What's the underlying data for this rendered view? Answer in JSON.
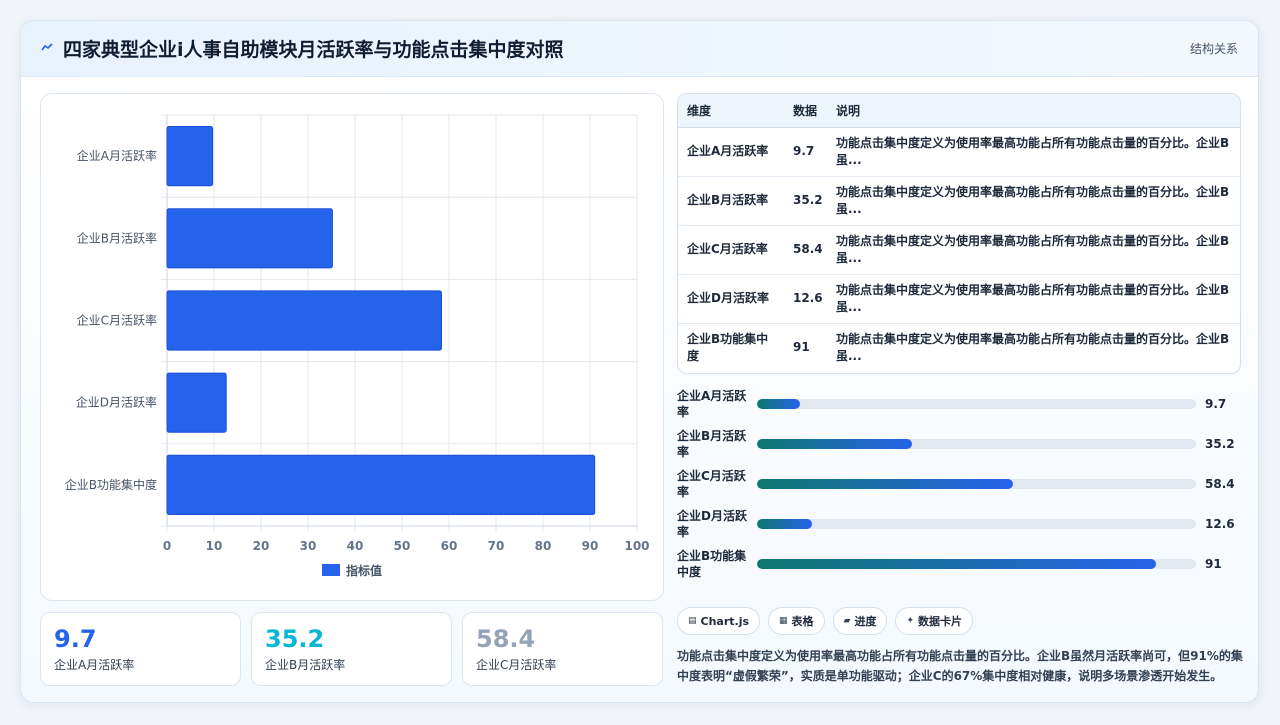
{
  "header": {
    "title": "四家典型企业i人事自助模块月活跃率与功能点击集中度对照",
    "tag": "结构关系",
    "icon": "trend-line-icon"
  },
  "chart_data": {
    "type": "bar",
    "orientation": "horizontal",
    "categories": [
      "企业A月活跃率",
      "企业B月活跃率",
      "企业C月活跃率",
      "企业D月活跃率",
      "企业B功能集中度"
    ],
    "series": [
      {
        "name": "指标值",
        "values": [
          9.7,
          35.2,
          58.4,
          12.6,
          91
        ],
        "color": "#2563eb"
      }
    ],
    "xlim": [
      0,
      100
    ],
    "x_ticks": [
      0,
      10,
      20,
      30,
      40,
      50,
      60,
      70,
      80,
      90,
      100
    ],
    "grid": true,
    "legend": "bottom"
  },
  "stats": [
    {
      "value": "9.7",
      "label": "企业A月活跃率",
      "color": "#2563eb"
    },
    {
      "value": "35.2",
      "label": "企业B月活跃率",
      "color": "#06b6d4"
    },
    {
      "value": "58.4",
      "label": "企业C月活跃率",
      "color": "#94a3b8"
    }
  ],
  "table": {
    "headers": [
      "维度",
      "数据",
      "说明"
    ],
    "rows": [
      {
        "dim": "企业A月活跃率",
        "val": "9.7",
        "desc": "功能点击集中度定义为使用率最高功能占所有功能点击量的百分比。企业B虽..."
      },
      {
        "dim": "企业B月活跃率",
        "val": "35.2",
        "desc": "功能点击集中度定义为使用率最高功能占所有功能点击量的百分比。企业B虽..."
      },
      {
        "dim": "企业C月活跃率",
        "val": "58.4",
        "desc": "功能点击集中度定义为使用率最高功能占所有功能点击量的百分比。企业B虽..."
      },
      {
        "dim": "企业D月活跃率",
        "val": "12.6",
        "desc": "功能点击集中度定义为使用率最高功能占所有功能点击量的百分比。企业B虽..."
      },
      {
        "dim": "企业B功能集中度",
        "val": "91",
        "desc": "功能点击集中度定义为使用率最高功能占所有功能点击量的百分比。企业B虽..."
      }
    ]
  },
  "progress": [
    {
      "label": "企业A月活跃率",
      "value": "9.7",
      "pct": 9.7
    },
    {
      "label": "企业B月活跃率",
      "value": "35.2",
      "pct": 35.2
    },
    {
      "label": "企业C月活跃率",
      "value": "58.4",
      "pct": 58.4
    },
    {
      "label": "企业D月活跃率",
      "value": "12.6",
      "pct": 12.6
    },
    {
      "label": "企业B功能集中度",
      "value": "91",
      "pct": 91
    }
  ],
  "buttons": [
    {
      "icon": "▤",
      "label": "Chart.js"
    },
    {
      "icon": "▦",
      "label": "表格"
    },
    {
      "icon": "▰",
      "label": "进度"
    },
    {
      "icon": "✦",
      "label": "数据卡片"
    }
  ],
  "note": "功能点击集中度定义为使用率最高功能占所有功能点击量的百分比。企业B虽然月活跃率尚可，但91%的集中度表明“虚假繁荣”，实质是单功能驱动；企业C的67%集中度相对健康，说明多场景渗透开始发生。"
}
